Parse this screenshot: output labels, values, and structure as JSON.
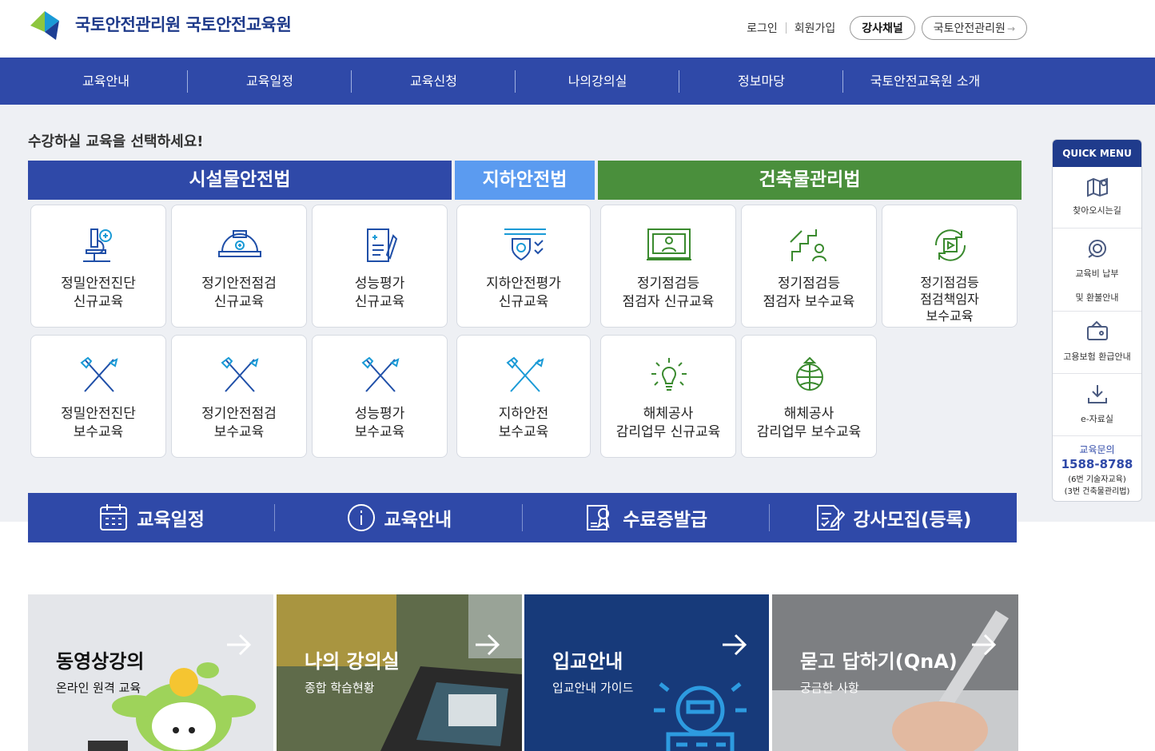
{
  "header": {
    "logo_text": "국토안전관리원 국토안전교육원",
    "util_links": [
      "로그인",
      "회원가입"
    ],
    "channel_button": "강사채널",
    "org_button": "국토안전관리원"
  },
  "gnb": [
    "교육안내",
    "교육일정",
    "교육신청",
    "나의강의실",
    "정보마당",
    "국토안전교육원 소개"
  ],
  "prompt": "수강하실 교육을 선택하세요!",
  "categories": [
    {
      "label": "시설물안전법",
      "color": "#2f49a8"
    },
    {
      "label": "지하안전법",
      "color": "#5b9bf0"
    },
    {
      "label": "건축물관리법",
      "color": "#4a8f3c"
    }
  ],
  "cards": [
    {
      "line1": "정밀안전진단",
      "line2": "신규교육",
      "icon": "microscope-icon"
    },
    {
      "line1": "정기안전점검",
      "line2": "신규교육",
      "icon": "helmet-icon"
    },
    {
      "line1": "성능평가",
      "line2": "신규교육",
      "icon": "document-pen-icon"
    },
    {
      "line1": "지하안전평가",
      "line2": "신규교육",
      "icon": "shield-icon"
    },
    {
      "line1": "정기점검등",
      "line2": "점검자 신규교육",
      "icon": "monitor-person-icon"
    },
    {
      "line1": "정기점검등",
      "line2": "점검자 보수교육",
      "icon": "stairs-person-icon"
    },
    {
      "line1": "정기점검등",
      "line2": "점검책임자",
      "line3": "보수교육",
      "icon": "refresh-play-icon"
    },
    {
      "line1": "정밀안전진단",
      "line2": "보수교육",
      "icon": "tools-icon"
    },
    {
      "line1": "정기안전점검",
      "line2": "보수교육",
      "icon": "tools-icon"
    },
    {
      "line1": "성능평가",
      "line2": "보수교육",
      "icon": "tools-icon"
    },
    {
      "line1": "지하안전",
      "line2": "보수교육",
      "icon": "tools-icon"
    },
    {
      "line1": "해체공사",
      "line2": "감리업무 신규교육",
      "icon": "lightbulb-icon"
    },
    {
      "line1": "해체공사",
      "line2": "감리업무 보수교육",
      "icon": "globe-tree-icon"
    }
  ],
  "bar": [
    {
      "label": "교육일정",
      "icon": "calendar-icon"
    },
    {
      "label": "교육안내",
      "icon": "info-icon"
    },
    {
      "label": "수료증발급",
      "icon": "certificate-icon"
    },
    {
      "label": "강사모집(등록)",
      "icon": "form-pen-icon"
    }
  ],
  "panels": [
    {
      "title": "동영상강의",
      "sub": "온라인 원격 교육",
      "bg": "#e4e6ea",
      "fg": "#111"
    },
    {
      "title": "나의 강의실",
      "sub": "종합 학습현황",
      "bg": "#6b6a4a",
      "fg": "#fff"
    },
    {
      "title": "입교안내",
      "sub": "입교안내 가이드",
      "bg": "#173a7a",
      "fg": "#fff"
    },
    {
      "title": "묻고 답하기(QnA)",
      "sub": "궁금한 사항",
      "bg": "#8a8c8f",
      "fg": "#fff"
    }
  ],
  "quick": {
    "title": "QUICK MENU",
    "items": [
      {
        "label": "찾아오시는길",
        "icon": "map-pin-icon"
      },
      {
        "label": "교육비 납부",
        "label2": "및 환불안내",
        "icon": "coin-icon"
      },
      {
        "label": "고용보험 환급안내",
        "icon": "wallet-icon"
      },
      {
        "label": "e-자료실",
        "icon": "download-icon"
      }
    ],
    "contact_label": "교육문의",
    "phone": "1588-8788",
    "note1": "(6번 기술자교육)",
    "note2": "(3번 건축물관리법)"
  }
}
